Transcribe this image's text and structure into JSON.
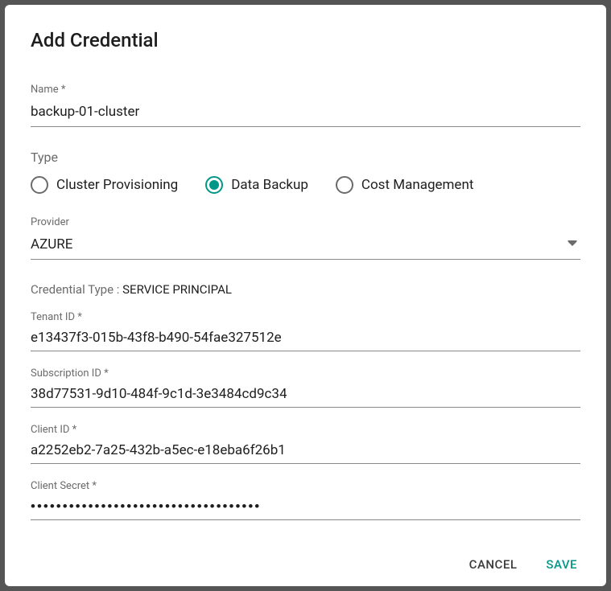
{
  "dialog": {
    "title": "Add Credential"
  },
  "name_field": {
    "label": "Name *",
    "value": "backup-01-cluster"
  },
  "type_section": {
    "label": "Type",
    "options": {
      "cluster_provisioning": "Cluster Provisioning",
      "data_backup": "Data Backup",
      "cost_management": "Cost Management"
    },
    "selected": "data_backup"
  },
  "provider_field": {
    "label": "Provider",
    "value": "AZURE"
  },
  "credential_type": {
    "label": "Credential Type :",
    "value": "SERVICE PRINCIPAL"
  },
  "tenant_id": {
    "label": "Tenant ID *",
    "value": "e13437f3-015b-43f8-b490-54fae327512e"
  },
  "subscription_id": {
    "label": "Subscription ID *",
    "value": "38d77531-9d10-484f-9c1d-3e3484cd9c34"
  },
  "client_id": {
    "label": "Client ID *",
    "value": "a2252eb2-7a25-432b-a5ec-e18eba6f26b1"
  },
  "client_secret": {
    "label": "Client Secret *",
    "value": "••••••••••••••••••••••••••••••••••••"
  },
  "actions": {
    "cancel": "CANCEL",
    "save": "SAVE"
  },
  "colors": {
    "accent": "#009688"
  }
}
